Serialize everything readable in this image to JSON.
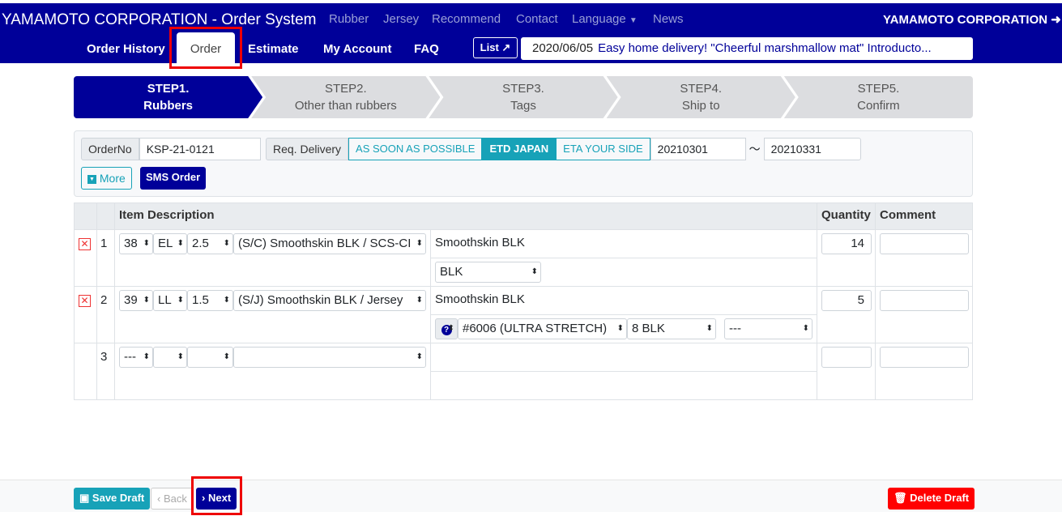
{
  "header": {
    "brand": "YAMAMOTO CORPORATION - Order System",
    "top_links": [
      "Rubber",
      "Jersey",
      "Recommend",
      "Contact",
      "Language",
      "News"
    ],
    "company": "YAMAMOTO CORPORATION",
    "sub_links": [
      "Order History",
      "Order",
      "Estimate",
      "My Account",
      "FAQ"
    ],
    "list_label": "List",
    "news_date": "2020/06/05",
    "news_text": "Easy home delivery! \"Cheerful marshmallow mat\" Introducto..."
  },
  "steps": [
    {
      "n": "STEP1.",
      "t": "Rubbers"
    },
    {
      "n": "STEP2.",
      "t": "Other than rubbers"
    },
    {
      "n": "STEP3.",
      "t": "Tags"
    },
    {
      "n": "STEP4.",
      "t": "Ship to"
    },
    {
      "n": "STEP5.",
      "t": "Confirm"
    }
  ],
  "form": {
    "order_no_label": "OrderNo",
    "order_no": "KSP-21-0121",
    "delivery_label": "Req. Delivery",
    "opt1": "AS SOON AS POSSIBLE",
    "opt2": "ETD JAPAN",
    "opt3": "ETA YOUR SIDE",
    "date_from": "20210301",
    "tilde": "〜",
    "date_to": "20210331",
    "more": "More",
    "sms": "SMS Order"
  },
  "table": {
    "headers": {
      "desc": "Item Description",
      "qty": "Quantity",
      "comment": "Comment"
    },
    "rows": [
      {
        "no": "1",
        "s1": "38",
        "s2": "EL",
        "s3": "2.5",
        "s4": "(S/C)   Smoothskin BLK / SCS-CI",
        "name": "Smoothskin BLK",
        "color": "BLK",
        "qty": "14"
      },
      {
        "no": "2",
        "s1": "39",
        "s2": "LL",
        "s3": "1.5",
        "s4": "(S/J)   Smoothskin BLK / Jersey",
        "name": "Smoothskin BLK",
        "jersey": "#6006 (ULTRA STRETCH)",
        "jcolor": "8 BLK",
        "jopt": "---",
        "qty": "5"
      },
      {
        "no": "3",
        "s1": "---",
        "s2": "",
        "s3": "",
        "s4": "",
        "qty": ""
      }
    ]
  },
  "footer": {
    "save": "Save Draft",
    "back": "Back",
    "next": "Next",
    "delete": "Delete Draft"
  },
  "colors": {
    "navbar": "#000099",
    "accent": "#17a2b8",
    "danger": "#ff0000"
  }
}
